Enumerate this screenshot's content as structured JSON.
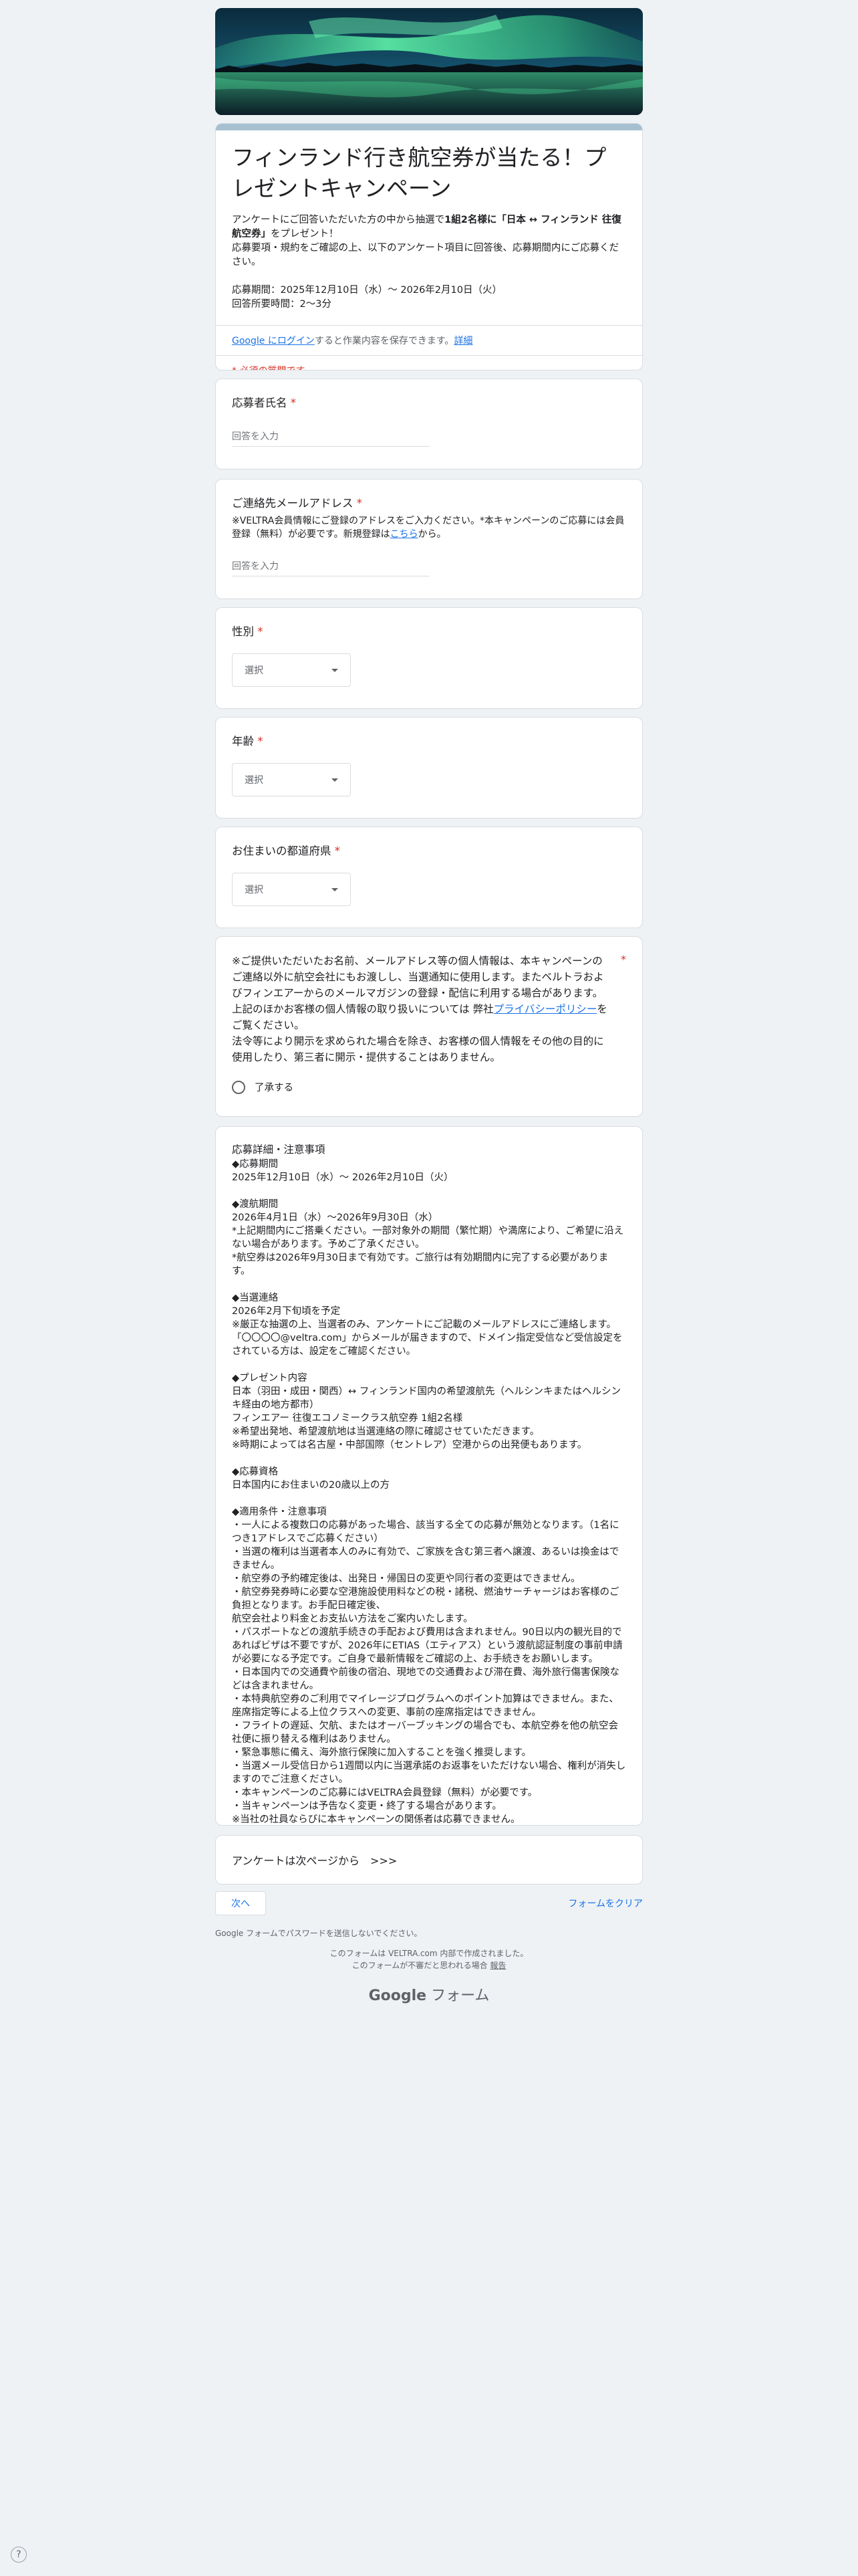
{
  "form": {
    "title": "フィンランド行き航空券が当たる！プレゼントキャンペーン",
    "desc_line1_pre": "アンケートにご回答いただいた方の中から抽選で",
    "desc_line1_bold": "1組2名様に「日本 ↔ フィンランド 往復航空券」",
    "desc_line1_post": "をプレゼント！",
    "desc_line2": "応募要項・規約をご確認の上、以下のアンケート項目に回答後、応募期間内にご応募ください。",
    "desc_period": "応募期間：2025年12月10日（水）〜 2026年2月10日（火）",
    "desc_time": "回答所要時間：2〜3分",
    "login_link": "Google にログイン",
    "login_text": "すると作業内容を保存できます。",
    "login_detail": "詳細",
    "required_note": "* 必須の質問です"
  },
  "questions": {
    "name": {
      "label": "応募者氏名",
      "placeholder": "回答を入力"
    },
    "email": {
      "label": "ご連絡先メールアドレス",
      "help_pre": "※VELTRA会員情報にご登録のアドレスをご入力ください。*本キャンペーンのご応募には会員登録（無料）が必要です。新規登録は",
      "help_link": "こちら",
      "help_post": "から。",
      "placeholder": "回答を入力"
    },
    "gender": {
      "label": "性別",
      "selected": "選択"
    },
    "age": {
      "label": "年齢",
      "selected": "選択"
    },
    "prefecture": {
      "label": "お住まいの都道府県",
      "selected": "選択"
    },
    "consent": {
      "line1": "※ご提供いただいたお名前、メールアドレス等の個人情報は、本キャンペーンのご連絡以外に航空会社にもお渡しし、当選通知に使用します。またベルトラおよびフィンエアーからのメールマガジンの登録・配信に利用する場合があります。",
      "line2_pre": "上記のほかお客様の個人情報の取り扱いについては 弊社",
      "line2_link": "プライバシーポリシー",
      "line2_post": "をご覧ください。",
      "line3": "法令等により開示を求められた場合を除き、お客様の個人情報をその他の目的に使用したり、第三者に開示・提供することはありません。",
      "option": "了承する"
    }
  },
  "details": {
    "heading": "応募詳細・注意事項",
    "lines": [
      "◆応募期間",
      "2025年12月10日（水）〜 2026年2月10日（火）",
      "",
      "◆渡航期間",
      "2026年4月1日（水）〜2026年9月30日（水）",
      "*上記期間内にご搭乗ください。一部対象外の期間（繁忙期）や満席により、ご希望に沿えない場合があります。予めご了承ください。",
      "*航空券は2026年9月30日まで有効です。ご旅行は有効期間内に完了する必要があります。",
      "",
      "◆当選連絡",
      "2026年2月下旬頃を予定",
      "※厳正な抽選の上、当選者のみ、アンケートにご記載のメールアドレスにご連絡します。「〇〇〇〇@veltra.com」からメールが届きますので、ドメイン指定受信など受信設定をされている方は、設定をご確認ください。",
      "",
      "◆プレゼント内容",
      "日本（羽田・成田・関西）↔ フィンランド国内の希望渡航先（ヘルシンキまたはヘルシンキ経由の地方都市）",
      "フィンエアー 往復エコノミークラス航空券 1組2名様",
      "※希望出発地、希望渡航地は当選連絡の際に確認させていただきます。",
      "※時期によっては名古屋・中部国際（セントレア）空港からの出発便もあります。",
      "",
      "◆応募資格",
      "日本国内にお住まいの20歳以上の方",
      "",
      "◆適用条件・注意事項",
      "・一人による複数口の応募があった場合、該当する全ての応募が無効となります。（1名につき1アドレスでご応募ください）",
      "・当選の権利は当選者本人のみに有効で、ご家族を含む第三者へ譲渡、あるいは換金はできません。",
      "・航空券の予約確定後は、出発日・帰国日の変更や同行者の変更はできません。",
      "・航空券発券時に必要な空港施設使用料などの税・諸税、燃油サーチャージはお客様のご負担となります。お手配日確定後、",
      "航空会社より料金とお支払い方法をご案内いたします。",
      "・パスポートなどの渡航手続きの手配および費用は含まれません。90日以内の観光目的であればビザは不要ですが、2026年にETIAS（エティアス）という渡航認証制度の事前申請が必要になる予定です。ご自身で最新情報をご確認の上、お手続きをお願いします。",
      "・日本国内での交通費や前後の宿泊、現地での交通費および滞在費、海外旅行傷害保険などは含まれません。",
      "・本特典航空券のご利用でマイレージプログラムへのポイント加算はできません。また、座席指定等による上位クラスへの変更、事前の座席指定はできません。",
      "・フライトの遅延、欠航、またはオーバーブッキングの場合でも、本航空券を他の航空会社便に振り替える権利はありません。",
      "・緊急事態に備え、海外旅行保険に加入することを強く推奨します。",
      "・当選メール受信日から1週間以内に当選承諾のお返事をいただけない場合、権利が消失しますのでご注意ください。",
      "・本キャンペーンのご応募にはVELTRA会員登録（無料）が必要です。",
      "・当キャンペーンは予告なく変更・終了する場合があります。",
      "※当社の社員ならびに本キャンペーンの関係者は応募できません。"
    ]
  },
  "next_note": "アンケートは次ページから　>>>",
  "buttons": {
    "next": "次へ",
    "clear": "フォームをクリア"
  },
  "footer": {
    "password_note": "Google フォームでパスワードを送信しないでください。",
    "created_by": "このフォームは VELTRA.com 内部で作成されました。",
    "report_pre": "このフォームが不審だと思われる場合 ",
    "report_link": "報告",
    "logo_google": "Google",
    "logo_forms": "フォーム",
    "help": "?"
  },
  "colors": {
    "accent": "#a6c0d0",
    "required": "#d93025",
    "link": "#1a73e8"
  }
}
